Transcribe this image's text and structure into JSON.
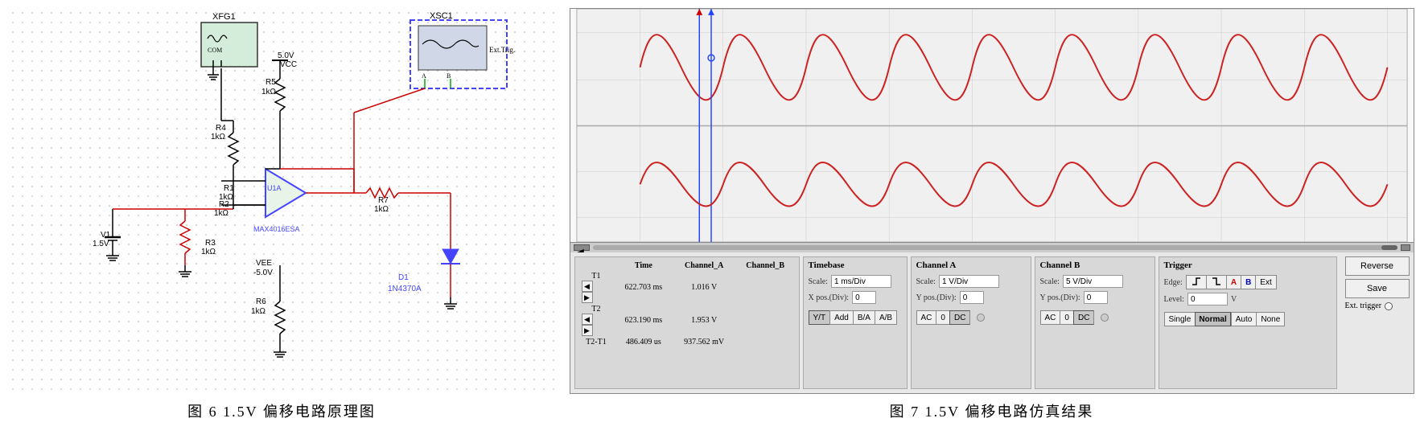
{
  "left": {
    "caption": "图 6  1.5V 偏移电路原理图"
  },
  "right": {
    "caption": "图 7  1.5V 偏移电路仿真结果",
    "measurements": {
      "header": [
        "",
        "Time",
        "Channel_A",
        "Channel_B"
      ],
      "t1": [
        "T1",
        "622.703 ms",
        "1.016 V",
        ""
      ],
      "t2": [
        "T2",
        "623.190 ms",
        "1.953 V",
        ""
      ],
      "t2t1": [
        "T2-T1",
        "486.409 us",
        "937.562 mV",
        ""
      ]
    },
    "timebase": {
      "label": "Timebase",
      "scale_label": "Scale:",
      "scale_value": "1 ms/Div",
      "xpos_label": "X pos.(Div):",
      "xpos_value": "0",
      "btn_yt": "Y/T",
      "btn_add": "Add",
      "btn_ba": "B/A",
      "btn_ab": "A/B"
    },
    "channel_a": {
      "label": "Channel A",
      "scale_label": "Scale:",
      "scale_value": "1 V/Div",
      "ypos_label": "Y pos.(Div):",
      "ypos_value": "0",
      "btn_ac": "AC",
      "btn_0": "0",
      "btn_dc": "DC"
    },
    "channel_b": {
      "label": "Channel B",
      "scale_label": "Scale:",
      "scale_value": "5 V/Div",
      "ypos_label": "Y pos.(Div):",
      "ypos_value": "0",
      "btn_ac": "AC",
      "btn_0": "0",
      "btn_dc": "DC"
    },
    "trigger": {
      "label": "Trigger",
      "edge_label": "Edge:",
      "level_label": "Level:",
      "level_value": "0",
      "level_unit": "V",
      "btn_reverse": "Reverse",
      "btn_save": "Save",
      "ext_trigger": "Ext. trigger",
      "btn_single": "Single",
      "btn_normal": "Normal",
      "btn_auto": "Auto",
      "btn_none": "None"
    }
  }
}
